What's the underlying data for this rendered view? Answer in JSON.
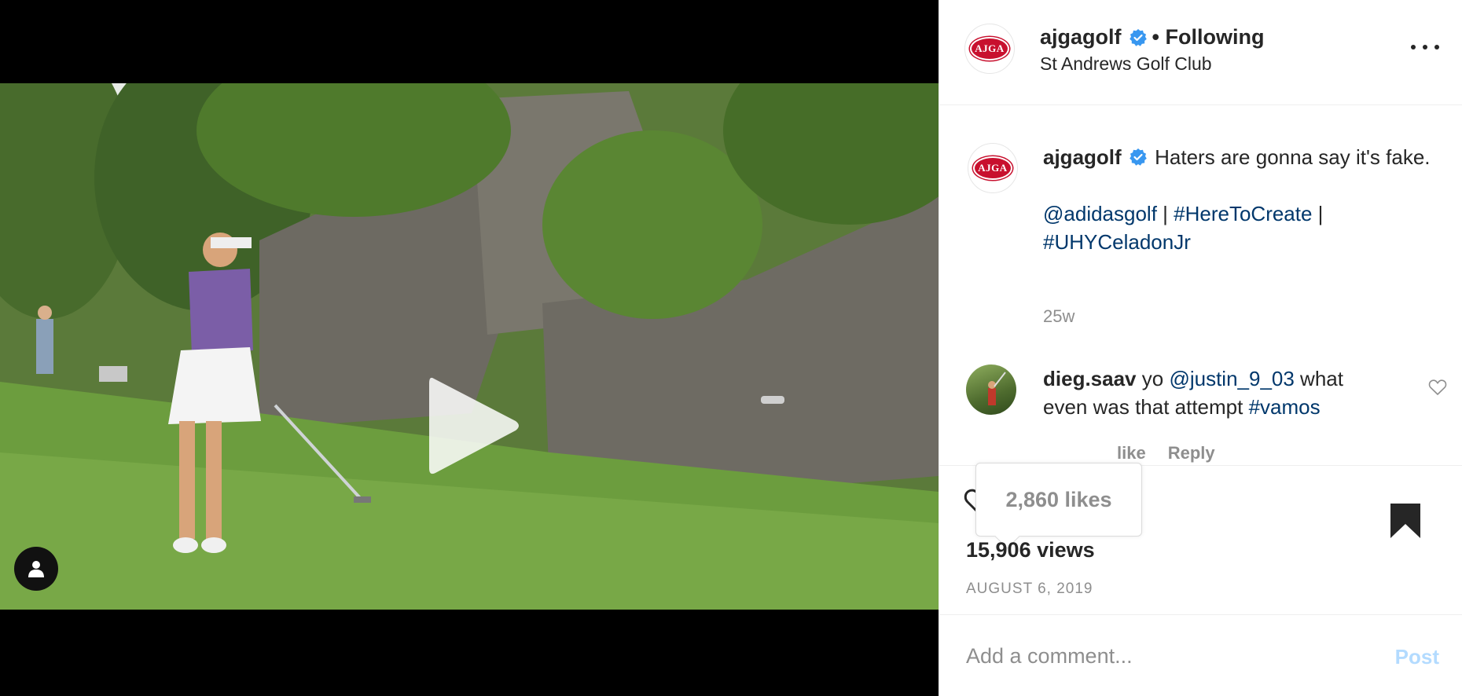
{
  "video": {
    "play_icon": "play-icon",
    "user_tag_icon": "person-icon"
  },
  "header": {
    "avatar_text": "AJGA",
    "username": "ajgagolf",
    "verified_icon": "verified-badge-icon",
    "following_label": "• Following",
    "location": "St Andrews Golf Club",
    "more_icon": "more-options-icon"
  },
  "caption": {
    "avatar_text": "AJGA",
    "username": "ajgagolf",
    "text": "Haters are gonna say it's fake.",
    "tags_line1": [
      "@adidasgolf",
      " | ",
      "#HereToCreate",
      " |"
    ],
    "tags_line2": "#UHYCeladonJr",
    "time": "25w"
  },
  "comment": {
    "username": "dieg.saav",
    "text_before": "yo ",
    "mention": "@justin_9_03",
    "text_middle": " what even was that attempt ",
    "hashtag": "#vamos",
    "like_label": "like",
    "reply_label": "Reply",
    "heart_icon": "heart-outline-icon"
  },
  "actions": {
    "icons": [
      "heart-icon",
      "comment-icon",
      "share-icon"
    ],
    "bookmark_icon": "bookmark-filled-icon",
    "likes_tooltip": "2,860 likes",
    "views": "15,906 views",
    "date": "AUGUST 6, 2019"
  },
  "add_comment": {
    "placeholder": "Add a comment...",
    "post_label": "Post"
  },
  "colors": {
    "link": "#00376b",
    "verified": "#3897f0",
    "post_disabled": "#b3dbff",
    "secondary_text": "#8e8e8e"
  }
}
